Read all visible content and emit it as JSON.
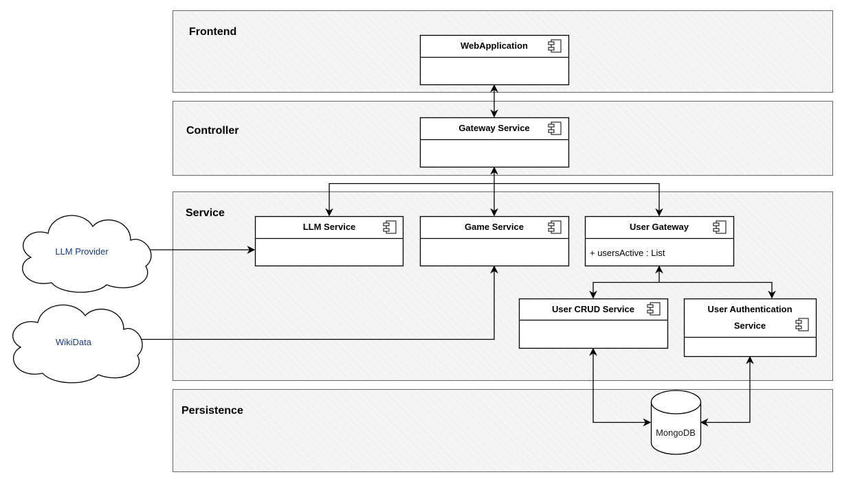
{
  "layers": {
    "frontend": "Frontend",
    "controller": "Controller",
    "service": "Service",
    "persistence": "Persistence"
  },
  "components": {
    "webapp": "WebApplication",
    "gateway": "Gateway Service",
    "llm": "LLM Service",
    "game": "Game Service",
    "user_gateway": "User Gateway",
    "user_gateway_attr": "+ usersActive : List",
    "user_crud": "User CRUD Service",
    "user_auth_line1": "User Authentication",
    "user_auth_line2": "Service"
  },
  "external": {
    "llm_provider": "LLM Provider",
    "wikidata": "WikiData"
  },
  "database": {
    "mongodb": "MongoDB"
  },
  "icons": [
    "component-icon",
    "cloud-icon",
    "database-cylinder-icon",
    "arrow-icon"
  ],
  "colors": {
    "layer_fill": "#f5f5f5",
    "layer_border": "#666666",
    "external_text": "#1a3a7a"
  }
}
